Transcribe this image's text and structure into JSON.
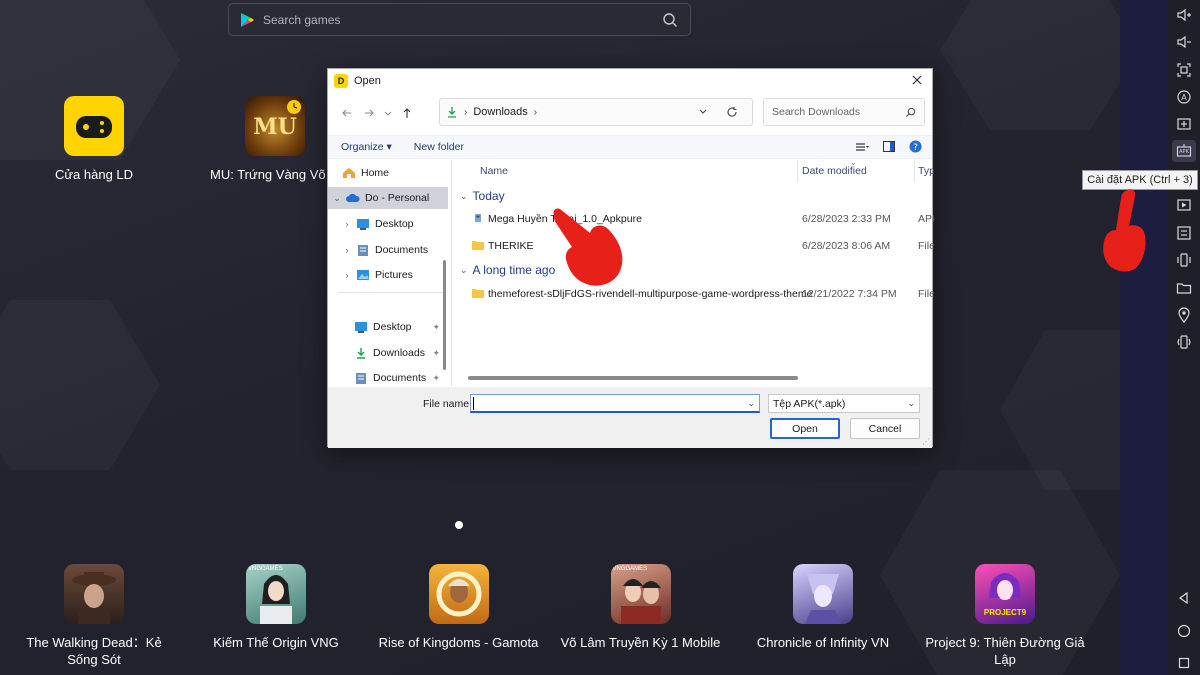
{
  "search": {
    "placeholder": "Search games"
  },
  "desktop_apps": [
    {
      "label": "Cửa hàng LD"
    },
    {
      "label": "MU: Trứng Vàng Võ H"
    }
  ],
  "dock_apps": [
    {
      "label": "The Walking Dead：Kẻ Sống Sót"
    },
    {
      "label": "Kiếm Thế Origin VNG"
    },
    {
      "label": "Rise of Kingdoms - Gamota"
    },
    {
      "label": "Võ Lâm Truyền Kỳ 1 Mobile"
    },
    {
      "label": "Chronicle of Infinity VN"
    },
    {
      "label": "Project 9: Thiên Đường Giả Lập"
    }
  ],
  "tile_texts": {
    "mu": "MU",
    "vng": "VNGGAMES",
    "project9": "PROJECT9"
  },
  "tooltip": "Cài đặt APK (Ctrl + 3)",
  "toolbar_apk_text": "APK",
  "dialog": {
    "title": "Open",
    "address": {
      "segment": "Downloads"
    },
    "search_placeholder": "Search Downloads",
    "commands": {
      "organize": "Organize ▾",
      "new_folder": "New folder"
    },
    "nav_items": [
      {
        "label": "Home"
      },
      {
        "label": "Do - Personal"
      },
      {
        "label": "Desktop"
      },
      {
        "label": "Documents"
      },
      {
        "label": "Pictures"
      },
      {
        "label": "Desktop"
      },
      {
        "label": "Downloads"
      },
      {
        "label": "Documents"
      }
    ],
    "columns": {
      "name": "Name",
      "date": "Date modified",
      "type": "Typ"
    },
    "groups": [
      {
        "label": "Today",
        "rows": [
          {
            "name": "Mega Huyền Thoại_1.0_Apkpure",
            "date": "6/28/2023 2:33 PM",
            "type": "APK"
          },
          {
            "name": "THERIKE",
            "date": "6/28/2023 8:06 AM",
            "type": "File"
          }
        ]
      },
      {
        "label": "A long time ago",
        "rows": [
          {
            "name": "themeforest-sDljFdGS-rivendell-multipurpose-game-wordpress-theme",
            "date": "12/21/2022 7:34 PM",
            "type": "File"
          }
        ]
      }
    ],
    "file_name_label": "File name:",
    "file_name_value": "",
    "file_type": "Tệp APK(*.apk)",
    "open_button": "Open",
    "cancel_button": "Cancel"
  },
  "colors": {
    "accent_red": "#e8201a",
    "ld_yellow": "#ffd400",
    "folder": "#f6c744"
  }
}
